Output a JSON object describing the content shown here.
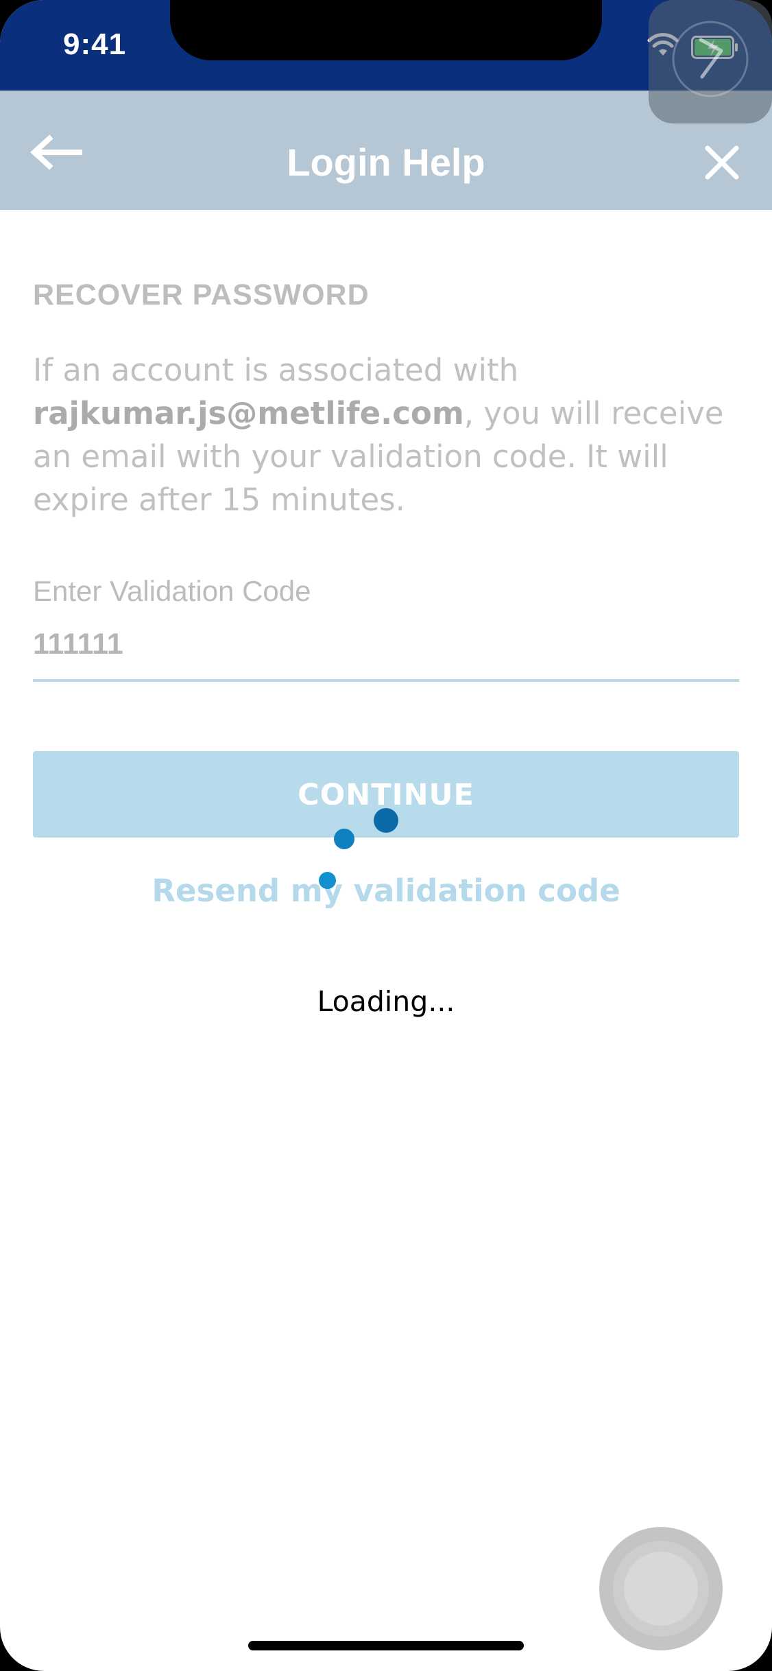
{
  "status_bar": {
    "time": "9:41",
    "wifi_icon": "wifi-icon",
    "battery_icon": "battery-charging-icon",
    "battery_color": "#4cd964"
  },
  "header": {
    "title": "Login Help",
    "back_icon": "arrow-left-icon",
    "close_icon": "close-icon",
    "background": "#b5c7d5"
  },
  "content": {
    "section_title": "RECOVER PASSWORD",
    "info_prefix": "If an account is associated with ",
    "email": "rajkumar.js@metlife.com",
    "info_suffix": ", you will receive an email with your validation code. It will expire after 15 minutes.",
    "field_label": "Enter Validation Code",
    "field_value": "111111",
    "continue_label": "CONTINUE",
    "resend_label": "Resend my validation code",
    "loading_text": "Loading..."
  },
  "colors": {
    "status_bar_bg": "#0a2f7c",
    "accent_light": "#b7dbeb",
    "spinner": "#0b6aa8"
  }
}
